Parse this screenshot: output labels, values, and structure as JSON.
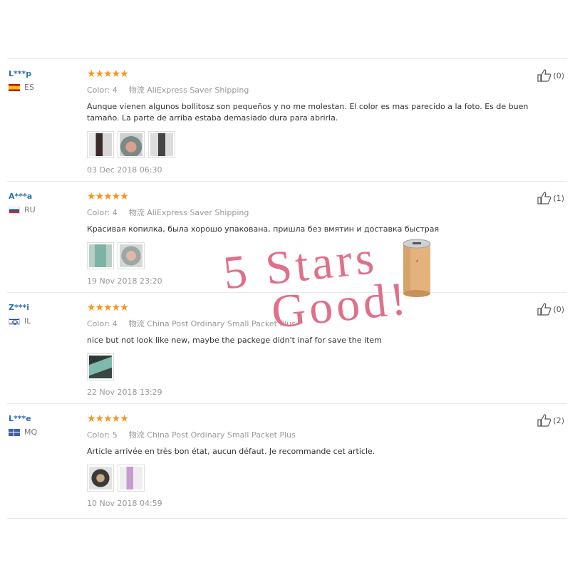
{
  "reviews": [
    {
      "user": "L***p",
      "country": "ES",
      "stars": "★★★★★",
      "color": "Color: 4",
      "shipping_label": "物流",
      "shipping": "AliExpress Saver Shipping",
      "text": "Aunque vienen algunos bollitosz son pequeños y no me molestan. El color es mas parecido a la foto. Es de buen tamaño. La parte de arriba estaba demasiado dura para abrirla.",
      "date": "03 Dec 2018 06:30",
      "helpful": "(0)"
    },
    {
      "user": "A***a",
      "country": "RU",
      "stars": "★★★★★",
      "color": "Color: 4",
      "shipping_label": "物流",
      "shipping": "AliExpress Saver Shipping",
      "text": "Красивая копилка, была хорошо упакована, пришла без вмятин и доставка быстрая",
      "date": "19 Nov 2018 23:20",
      "helpful": "(1)"
    },
    {
      "user": "Z***i",
      "country": "IL",
      "stars": "★★★★★",
      "color": "Color: 4",
      "shipping_label": "物流",
      "shipping": "China Post Ordinary Small Packet Plus",
      "text": "nice but not look like new, maybe the packege didn't inaf for save the item",
      "date": "22 Nov 2018 13:29",
      "helpful": "(0)"
    },
    {
      "user": "L***e",
      "country": "MQ",
      "stars": "★★★★★",
      "color": "Color: 5",
      "shipping_label": "物流",
      "shipping": "China Post Ordinary Small Packet Plus",
      "text": "Article arrivée en très bon état, aucun défaut. Je recommande cet article.",
      "date": "10 Nov 2018 04:59",
      "helpful": "(2)"
    }
  ],
  "overlay": {
    "line1": "5 Stars",
    "line2": "Good!",
    "color": "#e0708a"
  },
  "colors": {
    "username": "#2e6eb4",
    "star": "#f7941d",
    "muted": "#999999"
  }
}
